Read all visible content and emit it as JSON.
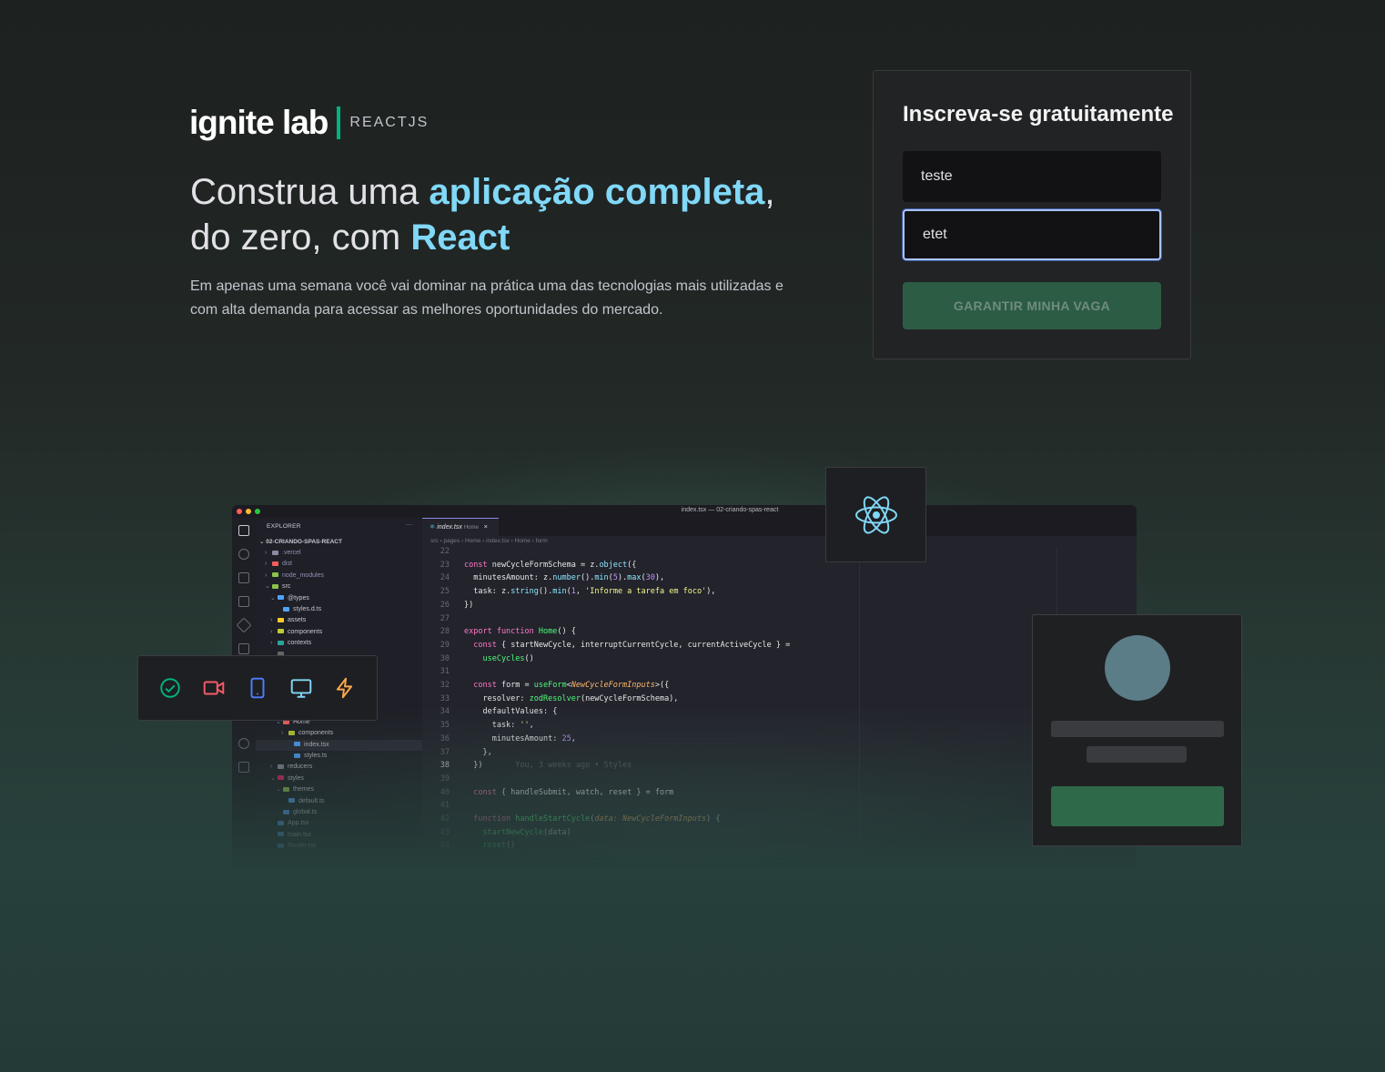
{
  "brand": {
    "name": "ignite lab",
    "product": "REACTJS",
    "accent": "#00b37e"
  },
  "hero": {
    "headline_part1": "Construa uma ",
    "headline_highlight1": "aplicação completa",
    "headline_part2": ",",
    "headline_part3": "do zero, com ",
    "headline_highlight2": "React",
    "description": "Em apenas uma semana você vai dominar na prática uma das tecnologias mais utilizadas e com alta demanda para acessar as melhores oportunidades do mercado."
  },
  "signup": {
    "title": "Inscreva-se gratuitamente",
    "name_value": "teste",
    "email_value": "etet",
    "submit_label": "GARANTIR MINHA VAGA"
  },
  "editor": {
    "window_title": "index.tsx — 02-criando-spas-react",
    "explorer_label": "EXPLORER",
    "explorer_more": "···",
    "project": "02-CRIANDO-SPAS-REACT",
    "tab_file": "index.tsx",
    "tab_folder": "Home",
    "tab_close": "×",
    "breadcrumb": [
      "src",
      "pages",
      "Home",
      "index.tsx",
      "Home",
      "form"
    ],
    "tree": [
      {
        "label": ".vercel",
        "indent": 1,
        "color": "#8a8aa0",
        "arrow": "›"
      },
      {
        "label": "dist",
        "indent": 1,
        "color": "#f25f5c",
        "arrow": "›"
      },
      {
        "label": "node_modules",
        "indent": 1,
        "color": "#8bc34a",
        "arrow": "›"
      },
      {
        "label": "src",
        "indent": 1,
        "color": "#8bc34a",
        "arrow": "⌄"
      },
      {
        "label": "@types",
        "indent": 2,
        "color": "#4fa3ff",
        "arrow": "⌄"
      },
      {
        "label": "styles.d.ts",
        "indent": 3,
        "color": "#4fa3ff",
        "arrow": ""
      },
      {
        "label": "assets",
        "indent": 2,
        "color": "#ffca28",
        "arrow": "›"
      },
      {
        "label": "components",
        "indent": 2,
        "color": "#c0ca33",
        "arrow": "›"
      },
      {
        "label": "contexts",
        "indent": 2,
        "color": "#26a69a",
        "arrow": "›"
      },
      {
        "label": "",
        "indent": 2,
        "color": "#666",
        "arrow": ""
      },
      {
        "label": "",
        "indent": 2,
        "color": "#666",
        "arrow": ""
      },
      {
        "label": "",
        "indent": 2,
        "color": "#666",
        "arrow": ""
      },
      {
        "label": "",
        "indent": 2,
        "color": "#666",
        "arrow": ""
      },
      {
        "label": "",
        "indent": 2,
        "color": "#666",
        "arrow": ""
      },
      {
        "label": "",
        "indent": 2,
        "color": "#666",
        "arrow": ""
      },
      {
        "label": "Home",
        "indent": 3,
        "color": "#f25f5c",
        "arrow": "⌄"
      },
      {
        "label": "components",
        "indent": 4,
        "color": "#c0ca33",
        "arrow": "›"
      },
      {
        "label": "index.tsx",
        "indent": 5,
        "color": "#4fa3ff",
        "arrow": "",
        "selected": true
      },
      {
        "label": "styles.ts",
        "indent": 5,
        "color": "#4fa3ff",
        "arrow": ""
      },
      {
        "label": "reducers",
        "indent": 2,
        "color": "#8a8aa0",
        "arrow": "›"
      },
      {
        "label": "styles",
        "indent": 2,
        "color": "#e91e63",
        "arrow": "⌄"
      },
      {
        "label": "themes",
        "indent": 3,
        "color": "#8bc34a",
        "arrow": "⌄"
      },
      {
        "label": "default.ts",
        "indent": 4,
        "color": "#4fa3ff",
        "arrow": ""
      },
      {
        "label": "global.ts",
        "indent": 3,
        "color": "#4fa3ff",
        "arrow": ""
      },
      {
        "label": "App.tsx",
        "indent": 2,
        "color": "#4fa3ff",
        "arrow": ""
      },
      {
        "label": "main.tsx",
        "indent": 2,
        "color": "#4fa3ff",
        "arrow": ""
      },
      {
        "label": "Router.tsx",
        "indent": 2,
        "color": "#4fa3ff",
        "arrow": ""
      }
    ],
    "line_numbers": [
      "22",
      "23",
      "24",
      "25",
      "26",
      "27",
      "28",
      "29",
      "30",
      "31",
      "32",
      "33",
      "34",
      "35",
      "36",
      "37",
      "38",
      "39",
      "40",
      "41",
      "42",
      "43",
      "44"
    ],
    "code_lines": [
      [],
      [
        [
          "kw",
          "const "
        ],
        [
          "",
          "newCycleFormSchema = "
        ],
        [
          "",
          "z."
        ],
        [
          "fn",
          "object"
        ],
        [
          "",
          "({"
        ]
      ],
      [
        [
          "",
          "  minutesAmount: z."
        ],
        [
          "fn",
          "number"
        ],
        [
          "",
          "()."
        ],
        [
          "fn",
          "min"
        ],
        [
          "",
          "("
        ],
        [
          "nu",
          "5"
        ],
        [
          "",
          ")."
        ],
        [
          "fn",
          "max"
        ],
        [
          "",
          "("
        ],
        [
          "nu",
          "30"
        ],
        [
          "",
          "),"
        ]
      ],
      [
        [
          "",
          "  task: z."
        ],
        [
          "fn",
          "string"
        ],
        [
          "",
          "()."
        ],
        [
          "fn",
          "min"
        ],
        [
          "",
          "("
        ],
        [
          "nu",
          "1"
        ],
        [
          "",
          ", "
        ],
        [
          "st",
          "'Informe a tarefa em foco'"
        ],
        [
          "",
          "),"
        ]
      ],
      [
        [
          "",
          "})"
        ]
      ],
      [],
      [
        [
          "kw",
          "export function "
        ],
        [
          "pr",
          "Home"
        ],
        [
          "",
          "() {"
        ]
      ],
      [
        [
          "kw",
          "  const "
        ],
        [
          "",
          "{ startNewCycle, interruptCurrentCycle, currentActiveCycle } ="
        ]
      ],
      [
        [
          "pr",
          "    useCycles"
        ],
        [
          "",
          "()"
        ]
      ],
      [],
      [
        [
          "kw",
          "  const "
        ],
        [
          "",
          "form = "
        ],
        [
          "pr",
          "useForm"
        ],
        [
          "",
          "<"
        ],
        [
          "ty",
          "NewCycleFormInputs"
        ],
        [
          "",
          ">({"
        ]
      ],
      [
        [
          "",
          "    resolver: "
        ],
        [
          "pr",
          "zodResolver"
        ],
        [
          "",
          "(newCycleFormSchema),"
        ]
      ],
      [
        [
          "",
          "    defaultValues: {"
        ]
      ],
      [
        [
          "",
          "      task: "
        ],
        [
          "st",
          "''"
        ],
        [
          "",
          ","
        ]
      ],
      [
        [
          "",
          "      minutesAmount: "
        ],
        [
          "nu",
          "25"
        ],
        [
          "",
          ","
        ]
      ],
      [
        [
          "",
          "    },"
        ]
      ],
      [
        [
          "",
          "  })"
        ],
        [
          "cm",
          "       You, 3 weeks ago • Styles"
        ]
      ],
      [],
      [
        [
          "kw",
          "  const "
        ],
        [
          "",
          "{ handleSubmit, watch, reset } = form"
        ]
      ],
      [],
      [
        [
          "kw",
          "  function "
        ],
        [
          "pr",
          "handleStartCycle"
        ],
        [
          "",
          "("
        ],
        [
          "ty",
          "data: NewCycleFormInputs"
        ],
        [
          "",
          ") {"
        ]
      ],
      [
        [
          "pr",
          "    startNewCycle"
        ],
        [
          "",
          "(data)"
        ]
      ],
      [
        [
          "pr",
          "    reset"
        ],
        [
          "",
          "()"
        ]
      ]
    ],
    "dot_colors": [
      "#ff5f57",
      "#febc2e",
      "#28c840"
    ]
  },
  "devices_widget": {
    "icons": [
      {
        "name": "check-circle-icon",
        "color": "#00b37e"
      },
      {
        "name": "video-camera-icon",
        "color": "#f75a68"
      },
      {
        "name": "smartphone-icon",
        "color": "#4f7dff"
      },
      {
        "name": "monitor-icon",
        "color": "#81d8f7"
      },
      {
        "name": "lightning-icon",
        "color": "#fba94c"
      }
    ]
  },
  "react_tile": {
    "icon": "react-logo-icon",
    "color": "#81d8f7"
  },
  "profile_card": {
    "avatar_color": "#5b7d87",
    "button_color": "#2e6a4a"
  }
}
